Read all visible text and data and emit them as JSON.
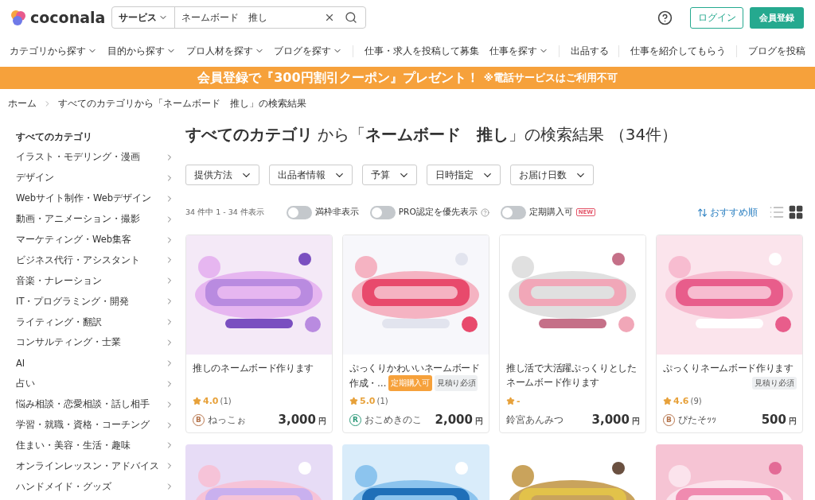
{
  "header": {
    "logo": "coconala",
    "search": {
      "scope": "サービス",
      "value": "ネームボード　推し"
    },
    "login": "ログイン",
    "register": "会員登録"
  },
  "nav": [
    {
      "label": "カテゴリから探す",
      "caret": true
    },
    {
      "label": "目的から探す",
      "caret": true
    },
    {
      "label": "プロ人材を探す",
      "caret": true
    },
    {
      "label": "ブログを探す",
      "caret": true
    },
    {
      "label": "仕事・求人を投稿して募集",
      "caret": false
    },
    {
      "label": "仕事を探す",
      "caret": true
    },
    {
      "label": "出品する",
      "caret": false
    },
    {
      "label": "仕事を紹介してもらう",
      "caret": false
    },
    {
      "label": "ブログを投稿",
      "caret": false
    }
  ],
  "banner": {
    "text": "会員登録で『300円割引クーポン』プレゼント！",
    "note": "※電話サービスはご利用不可"
  },
  "breadcrumb": [
    "ホーム",
    "すべてのカテゴリから「ネームボード　推し」の検索結果"
  ],
  "sidebar": {
    "title": "すべてのカテゴリ",
    "items": [
      "イラスト・モデリング・漫画",
      "デザイン",
      "Webサイト制作・Webデザイン",
      "動画・アニメーション・撮影",
      "マーケティング・Web集客",
      "ビジネス代行・アシスタント",
      "音楽・ナレーション",
      "IT・プログラミング・開発",
      "ライティング・翻訳",
      "コンサルティング・士業",
      "AI",
      "占い",
      "悩み相談・恋愛相談・話し相手",
      "学習・就職・資格・コーチング",
      "住まい・美容・生活・趣味",
      "オンラインレッスン・アドバイス",
      "ハンドメイド・グッズ"
    ]
  },
  "results": {
    "heading": "**すべてのカテゴリ** から「**ネームボード　推し**」の検索結果 （34件）",
    "filters": [
      "提供方法",
      "出品者情報",
      "予算",
      "日時指定",
      "お届け日数"
    ],
    "count": "34 件中 1 - 34 件表示",
    "toggles": [
      {
        "label": "満枠非表示",
        "on": false,
        "help": false
      },
      {
        "label": "PRO認定を優先表示",
        "on": false,
        "help": true
      },
      {
        "label": "定期購入可",
        "on": false,
        "help": false,
        "badge": "NEW"
      }
    ],
    "sort": "おすすめ順",
    "views": [
      {
        "kind": "list",
        "selected": false
      },
      {
        "kind": "grid",
        "selected": true
      }
    ],
    "cards": [
      {
        "kind": "listing",
        "title": "推しのネームボード作ります",
        "rating": "4.0",
        "reviews": "(1)",
        "seller": "ねっこぉ",
        "badge": "B",
        "color": "#b5734a",
        "price": "3,000",
        "currency": "円"
      },
      {
        "kind": "listing",
        "title": "ぷっくりかわいいネームボード作成・…",
        "tags": [
          {
            "label": "定期購入可",
            "kind": "subscription"
          },
          {
            "label": "見積り必須",
            "kind": "quote"
          }
        ],
        "rating": "5.0",
        "reviews": "(1)",
        "seller": "おこめきのこ",
        "badge": "R",
        "color": "#2e9a7a",
        "price": "2,000",
        "currency": "円"
      },
      {
        "kind": "listing",
        "title": "推し活で大活躍ぷっくりとしたネームボード作ります",
        "rating": "-",
        "seller": "鈴宮あんみつ",
        "price": "3,000",
        "currency": "円"
      },
      {
        "kind": "listing",
        "title": "ぷっくりネームボード作ります",
        "tags": [
          {
            "label": "見積り必須",
            "kind": "quote"
          }
        ],
        "rating": "4.6",
        "reviews": "(9)",
        "seller": "ぴたそｯｯ",
        "badge": "B",
        "color": "#b5734a",
        "price": "500",
        "currency": "円"
      },
      {
        "kind": "picture"
      },
      {
        "kind": "picture"
      },
      {
        "kind": "picture"
      },
      {
        "kind": "picture"
      }
    ]
  }
}
